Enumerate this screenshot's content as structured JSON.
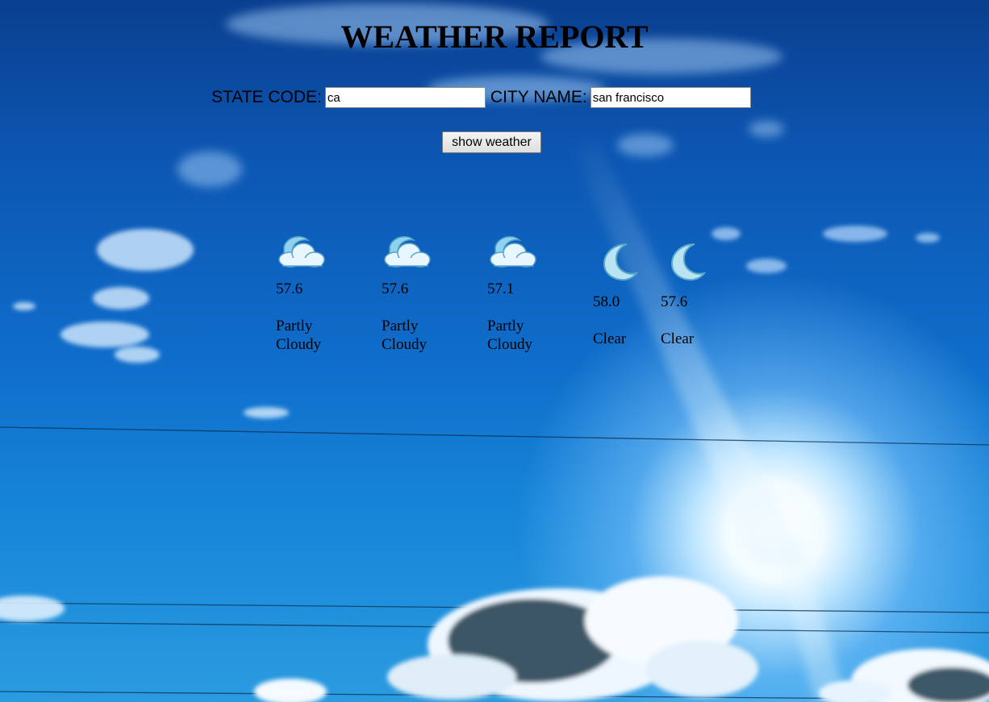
{
  "page": {
    "title": "WEATHER REPORT"
  },
  "form": {
    "state_label": "STATE CODE:",
    "state_value": "ca",
    "city_label": "CITY NAME:",
    "city_value": "san francisco",
    "submit_label": "show weather"
  },
  "forecast": [
    {
      "icon": "partly-cloudy-night-icon",
      "temp": "57.6",
      "condition": "Partly Cloudy"
    },
    {
      "icon": "partly-cloudy-night-icon",
      "temp": "57.6",
      "condition": "Partly Cloudy"
    },
    {
      "icon": "partly-cloudy-night-icon",
      "temp": "57.1",
      "condition": "Partly Cloudy"
    },
    {
      "icon": "crescent-moon-icon",
      "temp": "58.0",
      "condition": "Clear"
    },
    {
      "icon": "crescent-moon-icon",
      "temp": "57.6",
      "condition": "Clear"
    }
  ]
}
